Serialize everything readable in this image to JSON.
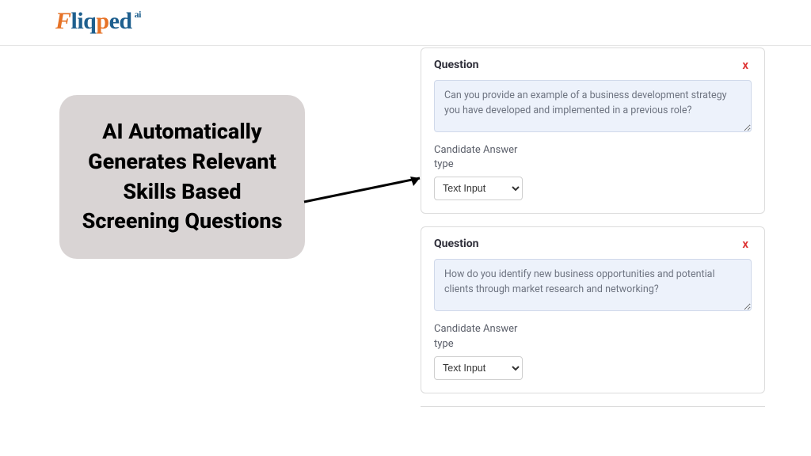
{
  "logo": {
    "text_parts": [
      "Fliq",
      "p",
      "ed",
      "ai"
    ]
  },
  "callout": {
    "text": "AI Automatically Generates Relevant Skills Based Screening Questions"
  },
  "questions": [
    {
      "heading": "Question",
      "close": "x",
      "text": "Can you provide an example of a business development strategy you have developed and implemented in a previous role?",
      "answer_label_line1": "Candidate Answer",
      "answer_label_line2": "type",
      "answer_type": "Text Input"
    },
    {
      "heading": "Question",
      "close": "x",
      "text": "How do you identify new business opportunities and potential clients through market research and networking?",
      "answer_label_line1": "Candidate Answer",
      "answer_label_line2": "type",
      "answer_type": "Text Input"
    }
  ]
}
